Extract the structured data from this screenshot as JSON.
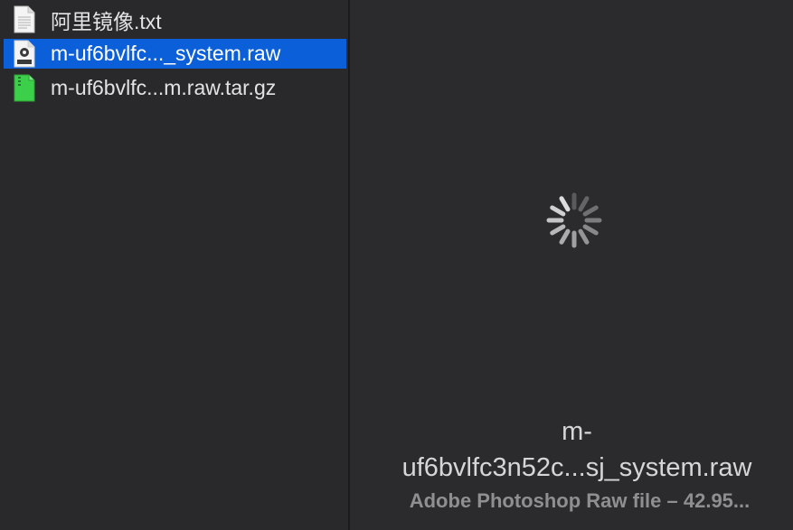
{
  "file_list": {
    "items": [
      {
        "name": "阿里镜像.txt",
        "icon": "text-document-icon",
        "selected": false
      },
      {
        "name": "m-uf6bvlfc..._system.raw",
        "icon": "raw-file-icon",
        "selected": true
      },
      {
        "name": "m-uf6bvlfc...m.raw.tar.gz",
        "icon": "archive-file-icon",
        "selected": false
      }
    ]
  },
  "preview": {
    "loading": true,
    "title_line1": "m-",
    "title_line2": "uf6bvlfc3n52c...sj_system.raw",
    "subtitle": "Adobe Photoshop Raw file – 42.95..."
  },
  "colors": {
    "selection": "#0b5fd9",
    "background": "#2a2a2c",
    "archive_green": "#3ccf4a"
  }
}
